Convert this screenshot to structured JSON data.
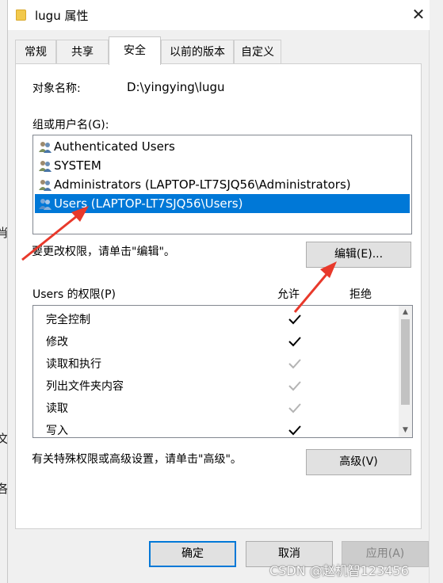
{
  "window": {
    "title": "lugu 属性",
    "close_glyph": "✕"
  },
  "tabs": [
    {
      "label": "常规"
    },
    {
      "label": "共享"
    },
    {
      "label": "安全"
    },
    {
      "label": "以前的版本"
    },
    {
      "label": "自定义"
    }
  ],
  "security": {
    "object_name_label": "对象名称:",
    "object_name_value": "D:\\yingying\\lugu",
    "group_label": "组或用户名(G):",
    "users": [
      {
        "name": "Authenticated Users"
      },
      {
        "name": "SYSTEM"
      },
      {
        "name": "Administrators (LAPTOP-LT7SJQ56\\Administrators)"
      },
      {
        "name": "Users (LAPTOP-LT7SJQ56\\Users)"
      }
    ],
    "selected_user_index": 3,
    "change_hint": "要更改权限，请单击\"编辑\"。",
    "edit_button": "编辑(E)...",
    "permissions_label": "Users 的权限(P)",
    "allow_header": "允许",
    "deny_header": "拒绝",
    "permissions": [
      {
        "name": "完全控制",
        "allow": "explicit"
      },
      {
        "name": "修改",
        "allow": "explicit"
      },
      {
        "name": "读取和执行",
        "allow": "inherited"
      },
      {
        "name": "列出文件夹内容",
        "allow": "inherited"
      },
      {
        "name": "读取",
        "allow": "inherited"
      },
      {
        "name": "写入",
        "allow": "explicit"
      }
    ],
    "advanced_hint": "有关特殊权限或高级设置，请单击\"高级\"。",
    "advanced_button": "高级(V)"
  },
  "footer": {
    "ok": "确定",
    "cancel": "取消",
    "apply": "应用(A)"
  },
  "background": {
    "glyph_1": "肖",
    "glyph_2": "文",
    "glyph_3": "各"
  },
  "watermark": "CSDN @赵机智123456",
  "colors": {
    "selection": "#0078d7",
    "annotation_arrow": "#e8392b",
    "check_inherited": "#b4b4b4"
  }
}
